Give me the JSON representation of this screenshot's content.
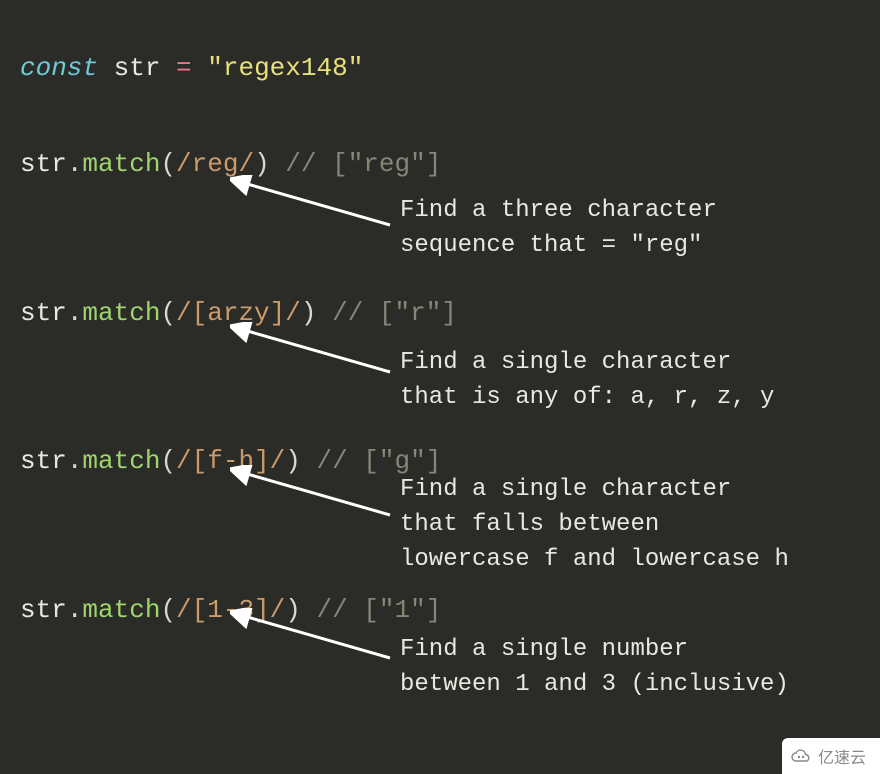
{
  "declaration": {
    "keyword": "const",
    "varname": "str",
    "eq": "=",
    "value": "\"regex148\""
  },
  "examples": [
    {
      "obj": "str",
      "method": "match",
      "regex": "/reg/",
      "result_comment": "// [\"reg\"]",
      "explain_line1": "Find a three character",
      "explain_line2": "sequence that = \"reg\""
    },
    {
      "obj": "str",
      "method": "match",
      "regex": "/[arzy]/",
      "result_comment": "// [\"r\"]",
      "explain_line1": "Find a single character",
      "explain_line2": "that is any of: a, r, z, y"
    },
    {
      "obj": "str",
      "method": "match",
      "regex": "/[f-h]/",
      "result_comment": "// [\"g\"]",
      "explain_line1": "Find a single character",
      "explain_line2": "that falls between",
      "explain_line3": "lowercase f and lowercase h"
    },
    {
      "obj": "str",
      "method": "match",
      "regex": "/[1-3]/",
      "result_comment": "// [\"1\"]",
      "explain_line1": "Find a single number",
      "explain_line2": "between 1 and 3 (inclusive)"
    }
  ],
  "watermark": "亿速云"
}
